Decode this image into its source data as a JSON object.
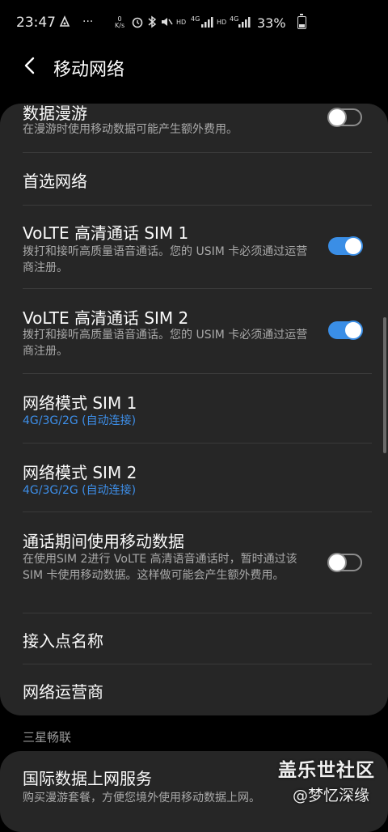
{
  "status_bar": {
    "time": "23:47",
    "dots": "···",
    "speed_top": "0",
    "speed_bottom": "K/s",
    "hd1": "HD",
    "net1": "4G",
    "hd2": "HD",
    "net2": "4G",
    "battery_pct": "33%",
    "icons": [
      "notification-icon",
      "alarm-icon",
      "bluetooth-icon",
      "mute-icon",
      "signal-icon",
      "battery-icon"
    ]
  },
  "header": {
    "title": "移动网络",
    "back_icon": "back-arrow-icon"
  },
  "items": {
    "roaming": {
      "title": "数据漫游",
      "subtitle": "在漫游时使用移动数据可能产生额外费用。",
      "toggle": "off"
    },
    "preferred": {
      "title": "首选网络"
    },
    "volte1": {
      "title": "VoLTE 高清通话 SIM 1",
      "subtitle": "拨打和接听高质量语音通话。您的 USIM 卡必须通过运营商注册。",
      "toggle": "on"
    },
    "volte2": {
      "title": "VoLTE 高清通话 SIM 2",
      "subtitle": "拨打和接听高质量语音通话。您的 USIM 卡必须通过运营商注册。",
      "toggle": "on"
    },
    "mode1": {
      "title": "网络模式 SIM 1",
      "subtitle": "4G/3G/2G (自动连接)"
    },
    "mode2": {
      "title": "网络模式 SIM 2",
      "subtitle": "4G/3G/2G (自动连接)"
    },
    "callData": {
      "title": "通话期间使用移动数据",
      "subtitle": "在使用SIM 2进行 VoLTE 高清语音通话时，暂时通过该 SIM 卡使用移动数据。这样做可能会产生额外费用。",
      "toggle": "off"
    },
    "apn": {
      "title": "接入点名称"
    },
    "operator": {
      "title": "网络运营商"
    }
  },
  "section2": {
    "label": "三星畅联",
    "item": {
      "title": "国际数据上网服务",
      "subtitle": "购买漫游套餐，方便您境外使用移动数据上网。"
    }
  },
  "watermark": {
    "line1": "盖乐世社区",
    "line2": "@梦忆深缘"
  },
  "colors": {
    "background": "#000000",
    "card": "#262626",
    "accent": "#3a8ee6",
    "subtitle": "#a9a9a9"
  }
}
